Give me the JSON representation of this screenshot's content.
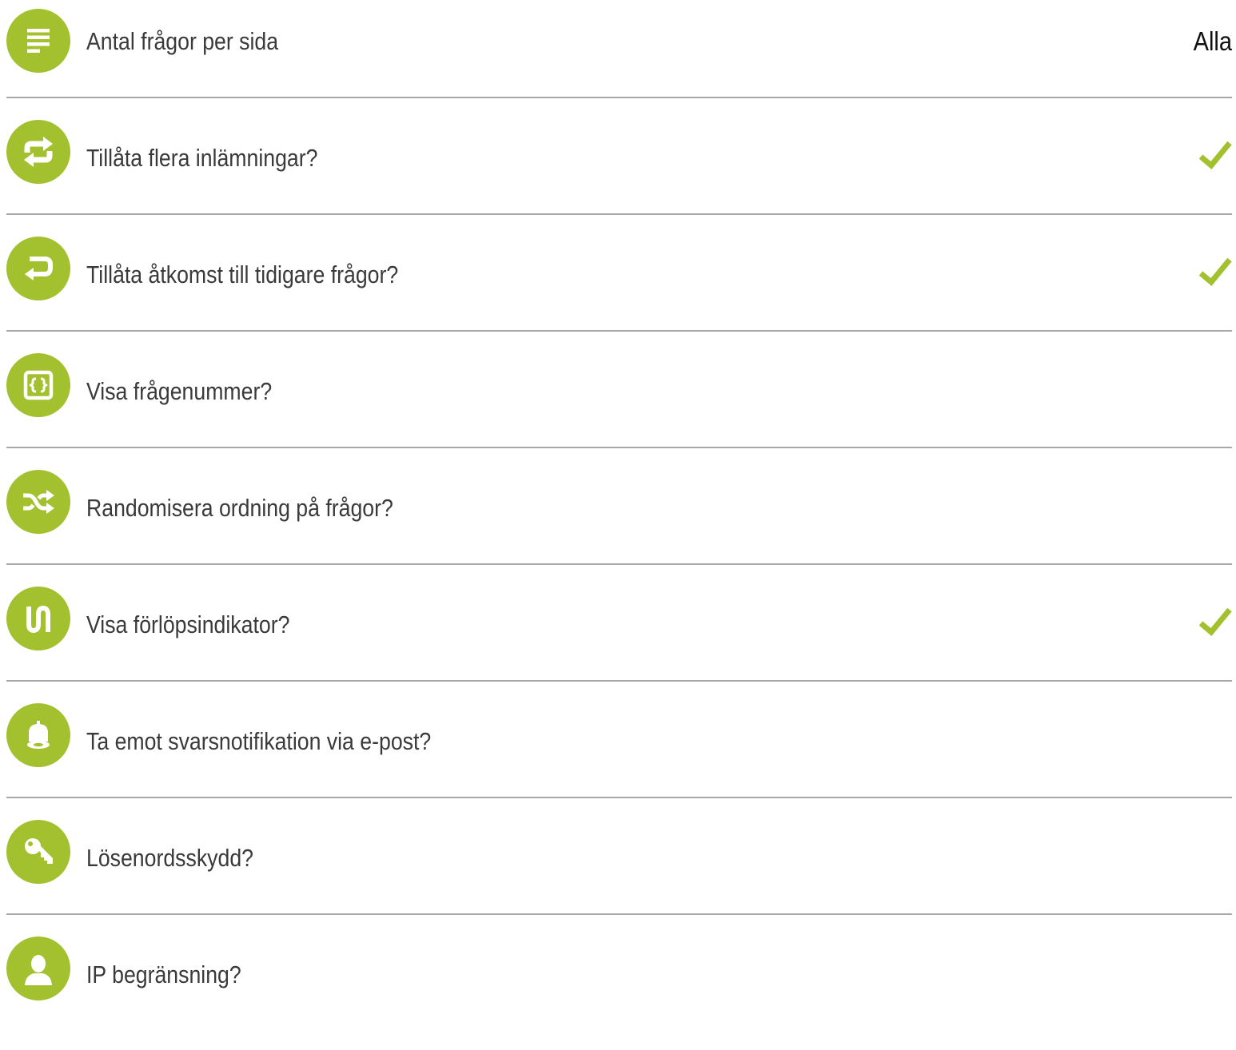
{
  "accent_color": "#a3c12e",
  "settings": [
    {
      "icon": "list-lines-icon",
      "label": "Antal frågor per sida",
      "value": "Alla"
    },
    {
      "icon": "repeat-arrows-icon",
      "label": "Tillåta flera inlämningar?",
      "checked": true
    },
    {
      "icon": "return-arrow-icon",
      "label": "Tillåta åtkomst till tidigare frågor?",
      "checked": true
    },
    {
      "icon": "braces-box-icon",
      "label": "Visa frågenummer?"
    },
    {
      "icon": "shuffle-icon",
      "label": "Randomisera ordning på frågor?"
    },
    {
      "icon": "progress-indicator-icon",
      "label": "Visa förlöpsindikator?",
      "checked": true
    },
    {
      "icon": "bell-icon",
      "label": "Ta emot svarsnotifikation via e-post?"
    },
    {
      "icon": "key-icon",
      "label": "Lösenordsskydd?"
    },
    {
      "icon": "user-icon",
      "label": "IP begränsning?"
    }
  ]
}
